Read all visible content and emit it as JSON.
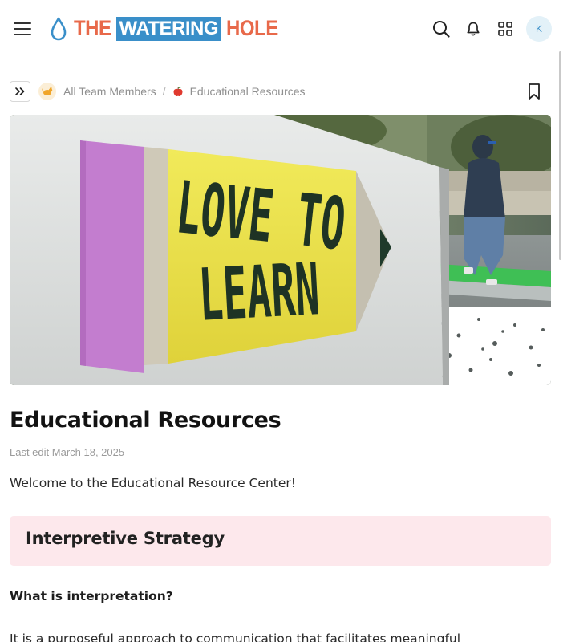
{
  "header": {
    "logo": {
      "word1": "THE",
      "word2": "WATERING",
      "word3": "HOLE"
    },
    "avatar_initial": "K",
    "icons": [
      "menu-icon",
      "search-icon",
      "bell-icon",
      "apps-grid-icon"
    ]
  },
  "breadcrumb": {
    "items": [
      {
        "label": "All Team Members",
        "icon": "cat-emoji-icon"
      },
      {
        "label": "Educational Resources",
        "icon": "apple-icon"
      }
    ],
    "separator": "/"
  },
  "hero": {
    "sign_line1": "LOVE TO",
    "sign_line2": "LEARN"
  },
  "page": {
    "title": "Educational Resources",
    "last_edit": "Last edit March 18, 2025",
    "welcome": "Welcome to the Educational Resource Center!",
    "callout_heading": "Interpretive Strategy",
    "subheading": "What is interpretation?",
    "paragraph": "It is a purposeful approach to communication that facilitates meaningful"
  },
  "colors": {
    "logo_orange": "#e8694a",
    "logo_blue": "#3a8fc9",
    "callout_bg": "#fde8ec",
    "avatar_bg": "#e3f1f8"
  }
}
